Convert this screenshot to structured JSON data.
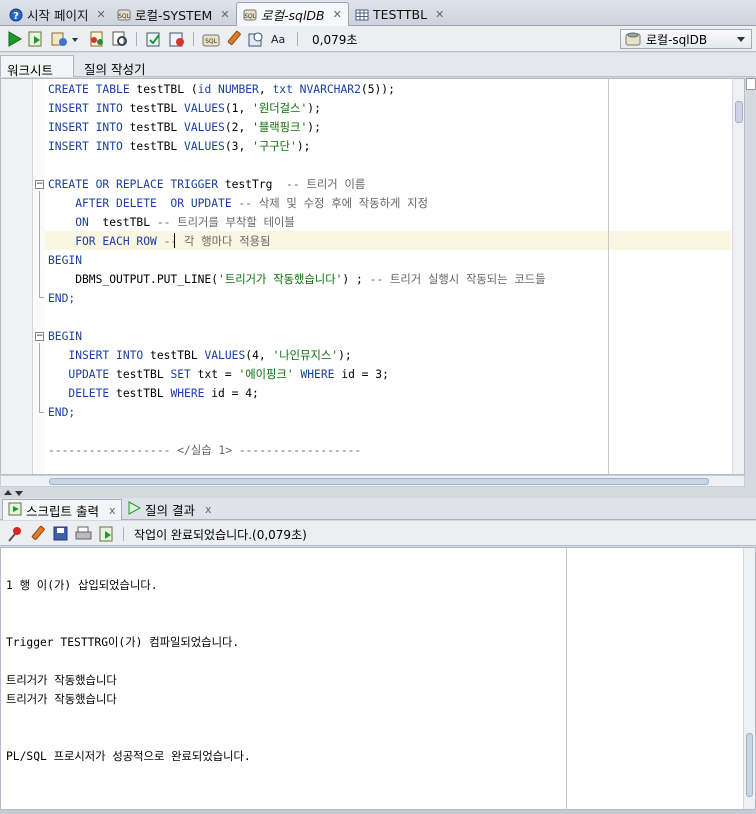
{
  "tabs": [
    {
      "label": "시작 페이지",
      "icon": "help-icon",
      "active": false
    },
    {
      "label": "로컬-SYSTEM",
      "icon": "sql-connection-icon",
      "active": false
    },
    {
      "label": "로컬-sqlDB",
      "icon": "sql-connection-icon",
      "active": true
    },
    {
      "label": "TESTTBL",
      "icon": "table-icon",
      "active": false
    }
  ],
  "toolbar": {
    "elapsed": "0,079초",
    "connection": "로컬-sqlDB"
  },
  "subtabs": [
    "워크시트",
    "질의 작성기"
  ],
  "editor": {
    "lines": [
      [
        {
          "t": "CREATE TABLE ",
          "c": "kw"
        },
        {
          "t": "testTBL (",
          "c": "plain"
        },
        {
          "t": "id NUMBER",
          "c": "kw"
        },
        {
          "t": ", ",
          "c": "plain"
        },
        {
          "t": "txt NVARCHAR2",
          "c": "kw"
        },
        {
          "t": "(5));",
          "c": "plain"
        }
      ],
      [
        {
          "t": "INSERT INTO ",
          "c": "kw"
        },
        {
          "t": "testTBL ",
          "c": "plain"
        },
        {
          "t": "VALUES",
          "c": "kw"
        },
        {
          "t": "(1, ",
          "c": "plain"
        },
        {
          "t": "'원더걸스'",
          "c": "str"
        },
        {
          "t": ");",
          "c": "plain"
        }
      ],
      [
        {
          "t": "INSERT INTO ",
          "c": "kw"
        },
        {
          "t": "testTBL ",
          "c": "plain"
        },
        {
          "t": "VALUES",
          "c": "kw"
        },
        {
          "t": "(2, ",
          "c": "plain"
        },
        {
          "t": "'블랙핑크'",
          "c": "str"
        },
        {
          "t": ");",
          "c": "plain"
        }
      ],
      [
        {
          "t": "INSERT INTO ",
          "c": "kw"
        },
        {
          "t": "testTBL ",
          "c": "plain"
        },
        {
          "t": "VALUES",
          "c": "kw"
        },
        {
          "t": "(3, ",
          "c": "plain"
        },
        {
          "t": "'구구단'",
          "c": "str"
        },
        {
          "t": ");",
          "c": "plain"
        }
      ],
      [],
      [
        {
          "t": "CREATE OR REPLACE TRIGGER ",
          "c": "kw"
        },
        {
          "t": "testTrg  ",
          "c": "plain"
        },
        {
          "t": "-- 트리거 이름",
          "c": "cmt"
        }
      ],
      [
        {
          "t": "    AFTER DELETE  OR UPDATE ",
          "c": "kw"
        },
        {
          "t": "-- 삭제 및 수정 후에 작동하게 지정",
          "c": "cmt"
        }
      ],
      [
        {
          "t": "    ON  ",
          "c": "kw"
        },
        {
          "t": "testTBL ",
          "c": "plain"
        },
        {
          "t": "-- 트리거를 부착할 테이블",
          "c": "cmt"
        }
      ],
      [
        {
          "t": "    FOR EACH ROW ",
          "c": "kw"
        },
        {
          "t": "-- 각 행마다 적용됨",
          "c": "cmt"
        }
      ],
      [
        {
          "t": "BEGIN",
          "c": "kw"
        }
      ],
      [
        {
          "t": "    DBMS_OUTPUT.PUT_LINE(",
          "c": "plain"
        },
        {
          "t": "'트리거가 작동했습니다'",
          "c": "str"
        },
        {
          "t": ") ; ",
          "c": "plain"
        },
        {
          "t": "-- 트리거 실행시 작동되는 코드들",
          "c": "cmt"
        }
      ],
      [
        {
          "t": "END;",
          "c": "kw"
        }
      ],
      [],
      [
        {
          "t": "BEGIN",
          "c": "kw"
        }
      ],
      [
        {
          "t": "   INSERT INTO ",
          "c": "kw"
        },
        {
          "t": "testTBL ",
          "c": "plain"
        },
        {
          "t": "VALUES",
          "c": "kw"
        },
        {
          "t": "(4, ",
          "c": "plain"
        },
        {
          "t": "'나인뮤지스'",
          "c": "str"
        },
        {
          "t": ");",
          "c": "plain"
        }
      ],
      [
        {
          "t": "   UPDATE ",
          "c": "kw"
        },
        {
          "t": "testTBL ",
          "c": "plain"
        },
        {
          "t": "SET ",
          "c": "kw"
        },
        {
          "t": "txt = ",
          "c": "plain"
        },
        {
          "t": "'에이핑크'",
          "c": "str"
        },
        {
          "t": " WHERE ",
          "c": "kw"
        },
        {
          "t": "id = 3;",
          "c": "plain"
        }
      ],
      [
        {
          "t": "   DELETE ",
          "c": "kw"
        },
        {
          "t": "testTBL ",
          "c": "plain"
        },
        {
          "t": "WHERE ",
          "c": "kw"
        },
        {
          "t": "id = 4;",
          "c": "plain"
        }
      ],
      [
        {
          "t": "END;",
          "c": "kw"
        }
      ],
      [],
      [
        {
          "t": "------------------ </실습 1> ------------------",
          "c": "cmt"
        }
      ]
    ]
  },
  "output": {
    "tabs": [
      {
        "label": "스크립트 출력",
        "icon": "script-output-icon"
      },
      {
        "label": "질의 결과",
        "icon": "run-icon"
      }
    ],
    "status": "작업이 완료되었습니다.(0,079초)",
    "lines": [
      "",
      "1 행 이(가) 삽입되었습니다.",
      "",
      "",
      "Trigger TESTTRG이(가) 컴파일되었습니다.",
      "",
      "트리거가 작동했습니다",
      "트리거가 작동했습니다",
      "",
      "",
      "PL/SQL 프로시저가 성공적으로 완료되었습니다."
    ]
  }
}
